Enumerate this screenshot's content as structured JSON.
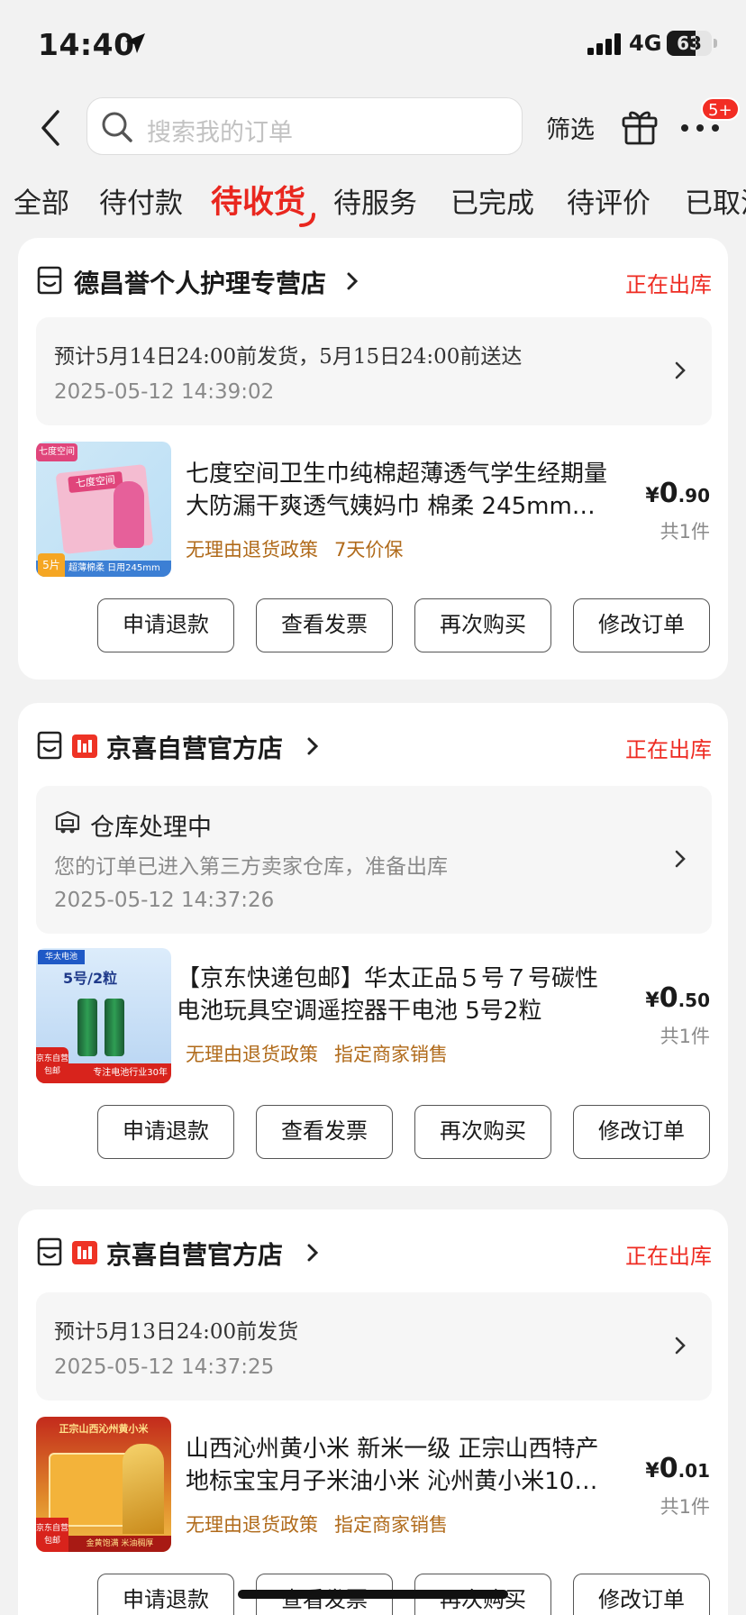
{
  "status_bar": {
    "time": "14:40",
    "network": "4G",
    "battery": "63",
    "battery_level": 0.63
  },
  "header": {
    "search_placeholder": "搜索我的订单",
    "filter_label": "筛选",
    "more_badge": "5+"
  },
  "tabs": [
    {
      "label": "全部"
    },
    {
      "label": "待付款"
    },
    {
      "label": "待收货",
      "active": true
    },
    {
      "label": "待服务"
    },
    {
      "label": "已完成"
    },
    {
      "label": "待评价"
    },
    {
      "label": "已取消"
    }
  ],
  "colors": {
    "accent": "#e9271f",
    "tag": "#b06a1a",
    "badge": "#f22d24"
  },
  "orders": [
    {
      "shop": "德昌誉个人护理专营店",
      "status": "正在出库",
      "info_line": "预计5月14日24:00前发货，5月15日24:00前送达",
      "info_time": "2025-05-12 14:39:02",
      "product": {
        "title": "七度空间卫生巾纯棉超薄透气学生经期量大防漏干爽透气姨妈巾 棉柔 245mm…",
        "tags": [
          "无理由退货政策",
          "7天价保"
        ],
        "price_int": "0",
        "price_dec": ".90",
        "currency": "¥",
        "qty": "共1件",
        "image_text_1": "七度空间",
        "image_text_2": "超薄棉柔 日用245mm",
        "image_text_3": "5片"
      },
      "actions": [
        "申请退款",
        "查看发票",
        "再次购买",
        "修改订单"
      ]
    },
    {
      "shop": "京喜自营官方店",
      "status": "正在出库",
      "info_title": "仓库处理中",
      "info_sub": "您的订单已进入第三方卖家仓库，准备出库",
      "info_time": "2025-05-12 14:37:26",
      "product": {
        "title": "【京东快递包邮】华太正品５号７号碳性电池玩具空调遥控器干电池 5号2粒",
        "tags": [
          "无理由退货政策",
          "指定商家销售"
        ],
        "price_int": "0",
        "price_dec": ".50",
        "currency": "¥",
        "qty": "共1件",
        "image_text_1": "华太电池",
        "image_text_2": "5号/2粒",
        "image_text_3": "京东自营 包邮",
        "image_text_4": "专注电池行业30年"
      },
      "actions": [
        "申请退款",
        "查看发票",
        "再次购买",
        "修改订单"
      ]
    },
    {
      "shop": "京喜自营官方店",
      "status": "正在出库",
      "info_line": "预计5月13日24:00前发货",
      "info_time": "2025-05-12 14:37:25",
      "product": {
        "title": "山西沁州黄小米 新米一级 正宗山西特产地标宝宝月子米油小米 沁州黄小米10…",
        "tags": [
          "无理由退货政策",
          "指定商家销售"
        ],
        "price_int": "0",
        "price_dec": ".01",
        "currency": "¥",
        "qty": "共1件",
        "image_text_1": "正宗山西沁州黄小米",
        "image_text_2": "金黄饱满 米油稠厚",
        "image_text_3": "京东自营 包邮"
      },
      "actions": [
        "申请退款",
        "查看发票",
        "再次购买",
        "修改订单"
      ]
    }
  ]
}
